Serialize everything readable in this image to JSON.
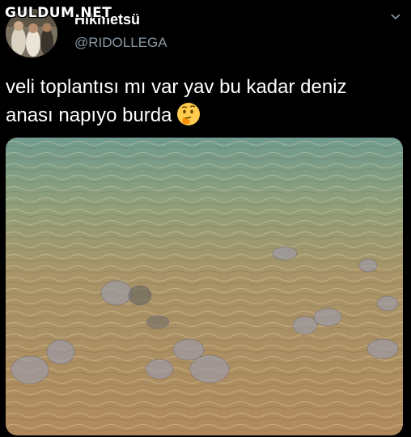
{
  "watermark": {
    "text": "GULDUM.NET"
  },
  "user": {
    "display_name": "Hikmetsü",
    "handle": "@RIDOLLEGA"
  },
  "tweet": {
    "text_line1": "veli toplantısı mı var yav bu kadar deniz",
    "text_line2": "anası napıyo burda",
    "emoji": "thinking-face-emoji"
  },
  "icons": {
    "menu": "chevron-down-icon"
  },
  "colors": {
    "background": "#000000",
    "text": "#ffffff",
    "secondary_text": "#8899a6"
  }
}
